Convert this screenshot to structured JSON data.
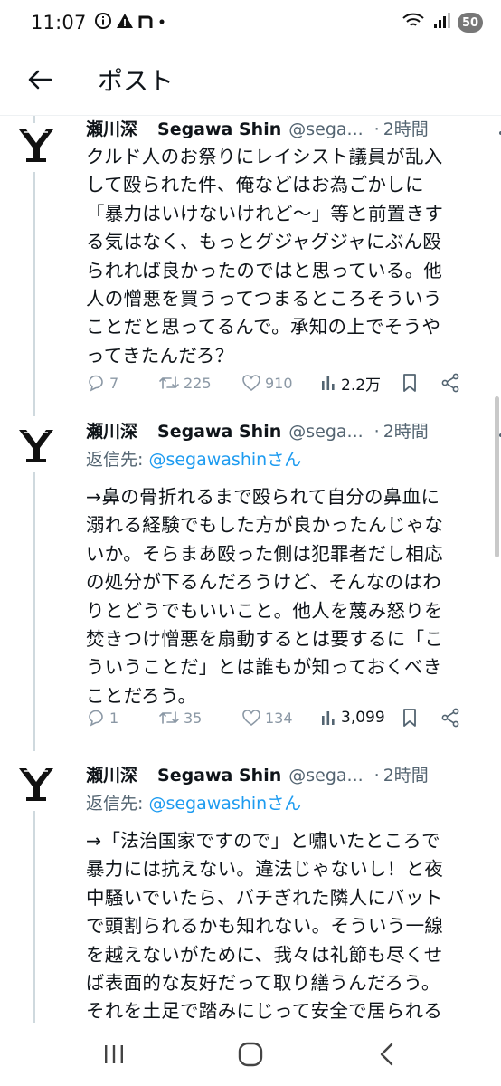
{
  "status_bar": {
    "time": "11:07",
    "battery": "50"
  },
  "header": {
    "title": "ポスト"
  },
  "posts": [
    {
      "name": "瀬川深",
      "display_en": "Segawa Shin",
      "handle": "@sega...",
      "dot": "·",
      "time": "2時間",
      "lines": [
        "クルド人のお祭りにレイシスト議員が乱入",
        "して殴られた件、俺などはお為ごかしに",
        "「暴力はいけないけれど〜」等と前置きす",
        "る気はなく、もっとグジャグジャにぶん殴",
        "られれば良かったのではと思っている。他",
        "人の憎悪を買うってつまるところそういう",
        "ことだと思ってるんで。承知の上でそうや",
        "ってきたんだろ？"
      ],
      "replies": "7",
      "reposts": "225",
      "likes": "910",
      "views": "2.2万"
    },
    {
      "name": "瀬川深",
      "display_en": "Segawa Shin",
      "handle": "@sega...",
      "dot": "·",
      "time": "2時間",
      "reply_prefix": "返信先: ",
      "reply_user": "@segawashinさん",
      "lines": [
        "→鼻の骨折れるまで殴られて自分の鼻血に",
        "溺れる経験でもした方が良かったんじゃな",
        "いか。そらまあ殴った側は犯罪者だし相応",
        "の処分が下るんだろうけど、そんなのはわ",
        "りとどうでもいいこと。他人を蔑み怒りを",
        "焚きつけ憎悪を扇動するとは要するに「こ",
        "ういうことだ」とは誰もが知っておくべき",
        "ことだろう。"
      ],
      "replies": "1",
      "reposts": "35",
      "likes": "134",
      "views": "3,099"
    },
    {
      "name": "瀬川深",
      "display_en": "Segawa Shin",
      "handle": "@sega...",
      "dot": "·",
      "time": "2時間",
      "reply_prefix": "返信先: ",
      "reply_user": "@segawashinさん",
      "lines": [
        "→「法治国家ですので」と嘯いたところで",
        "暴力には抗えない。違法じゃないし！と夜",
        "中騒いでいたら、バチぎれた隣人にバット",
        "で頭割られるかも知れない。そういう一線",
        "を越えないがために、我々は礼節も尽くせ",
        "ば表面的な友好だって取り繕うんだろう。",
        "それを土足で踏みにじって安全で居られる"
      ]
    }
  ],
  "colors": {
    "text": "#0f1419",
    "secondary": "#536471",
    "action_gray": "#8b98a5",
    "link": "#1d9bf0",
    "rail": "#cfd9de"
  },
  "icons": {
    "back": "arrow-left-icon",
    "reply": "reply-bubble-icon",
    "repost": "repost-icon",
    "like": "heart-icon",
    "views": "bar-chart-icon",
    "bookmark": "bookmark-icon",
    "share": "share-icon"
  }
}
